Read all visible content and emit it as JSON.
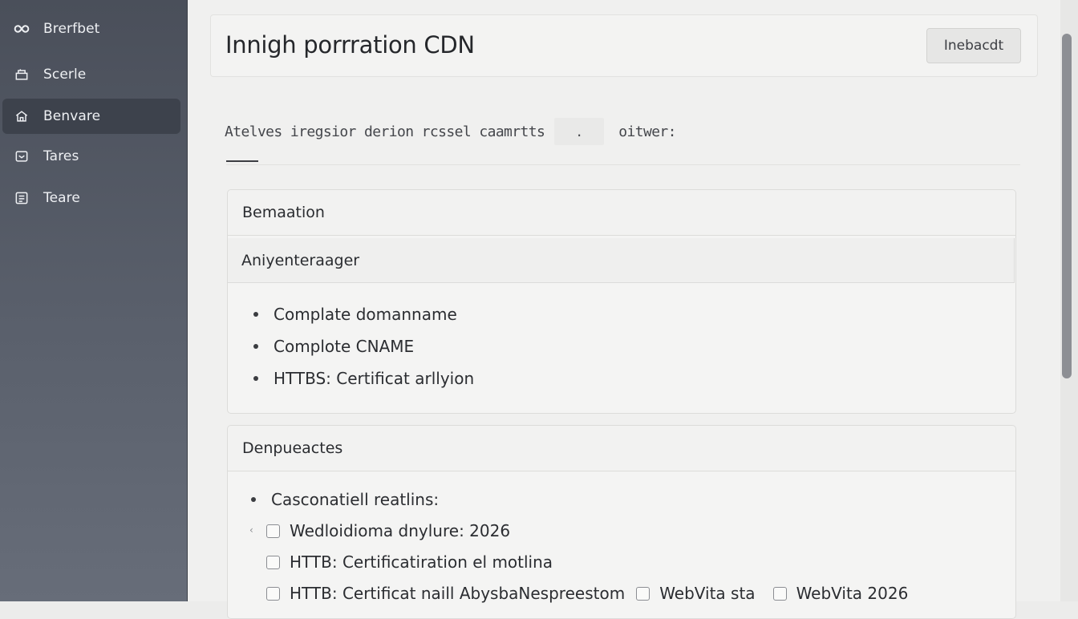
{
  "sidebar": {
    "items": [
      {
        "label": "Brerfbet",
        "icon": "infinity-icon"
      },
      {
        "label": "Scerle",
        "icon": "store-icon"
      },
      {
        "label": "Benvare",
        "icon": "home-icon",
        "active": true
      },
      {
        "label": "Tares",
        "icon": "message-icon"
      },
      {
        "label": "Teare",
        "icon": "list-icon"
      }
    ]
  },
  "header": {
    "title": "Innigh porrration CDN",
    "button_label": "Inebacdt"
  },
  "description": {
    "text": "Atelves iregsior derion rcssel caamrtts",
    "input_value": ".",
    "suffix": "oitwer:"
  },
  "section1": {
    "title": "Bemaation",
    "subtitle": "Aniyenteraager",
    "items": [
      "Complate domanname",
      "Complote CNAME",
      "HTTBS: Certificat arllyion"
    ]
  },
  "section2": {
    "title": "Denpueactes",
    "bullet": "Casconatiell reatlins:",
    "checks": [
      "Wedloidioma dnylure: 2026",
      "HTTB: Certificatiration el motlina",
      "HTTB: Certificat naill AbysbaNespreestom"
    ],
    "inline_checks": [
      "WebVita sta",
      "WebVita 2026"
    ]
  },
  "colors": {
    "sidebar_bg": "#525865",
    "sidebar_active": "#3d424c",
    "main_bg": "#f0f0ef",
    "card_border": "#dcdcda"
  }
}
